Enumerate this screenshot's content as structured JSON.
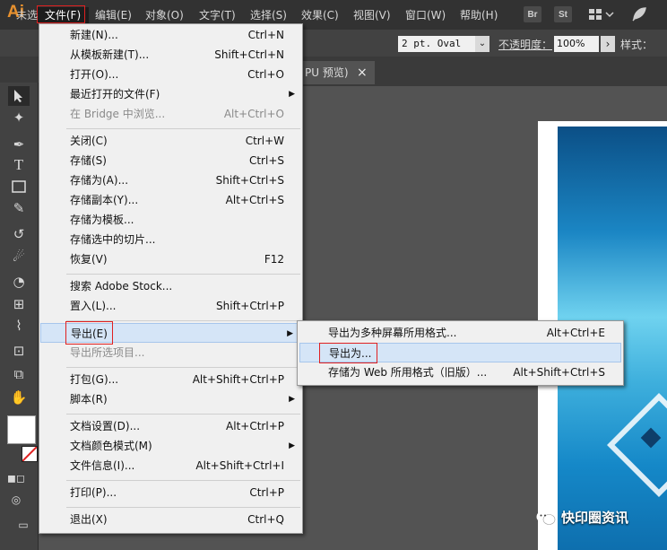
{
  "app": {
    "logo": "Ai"
  },
  "menubar": {
    "items": [
      "文件(F)",
      "编辑(E)",
      "对象(O)",
      "文字(T)",
      "选择(S)",
      "效果(C)",
      "视图(V)",
      "窗口(W)",
      "帮助(H)"
    ],
    "icons": {
      "bridge": "Br",
      "stock": "St",
      "workspace": "workspace-grid-icon",
      "feather": "feather-icon"
    }
  },
  "control_bar": {
    "selection_text": "未选",
    "stroke_profile": "2 pt. Oval",
    "opacity_label": "不透明度：",
    "opacity_value": "100%",
    "style_label": "样式："
  },
  "doc_tab": {
    "title": "PU 预览)",
    "close": "×"
  },
  "file_menu": {
    "items": [
      {
        "label": "新建(N)...",
        "shortcut": "Ctrl+N"
      },
      {
        "label": "从模板新建(T)...",
        "shortcut": "Shift+Ctrl+N"
      },
      {
        "label": "打开(O)...",
        "shortcut": "Ctrl+O"
      },
      {
        "label": "最近打开的文件(F)",
        "shortcut": "▶"
      },
      {
        "label": "在 Bridge 中浏览...",
        "shortcut": "Alt+Ctrl+O"
      },
      {
        "label": "关闭(C)",
        "shortcut": "Ctrl+W"
      },
      {
        "label": "存储(S)",
        "shortcut": "Ctrl+S"
      },
      {
        "label": "存储为(A)...",
        "shortcut": "Shift+Ctrl+S"
      },
      {
        "label": "存储副本(Y)...",
        "shortcut": "Alt+Ctrl+S"
      },
      {
        "label": "存储为模板...",
        "shortcut": ""
      },
      {
        "label": "存储选中的切片...",
        "shortcut": ""
      },
      {
        "label": "恢复(V)",
        "shortcut": "F12"
      },
      {
        "label": "搜索 Adobe Stock...",
        "shortcut": ""
      },
      {
        "label": "置入(L)...",
        "shortcut": "Shift+Ctrl+P"
      },
      {
        "label": "导出(E)",
        "shortcut": "▶"
      },
      {
        "label": "导出所选项目...",
        "shortcut": ""
      },
      {
        "label": "打包(G)...",
        "shortcut": "Alt+Shift+Ctrl+P"
      },
      {
        "label": "脚本(R)",
        "shortcut": "▶"
      },
      {
        "label": "文档设置(D)...",
        "shortcut": "Alt+Ctrl+P"
      },
      {
        "label": "文档颜色模式(M)",
        "shortcut": "▶"
      },
      {
        "label": "文件信息(I)...",
        "shortcut": "Alt+Shift+Ctrl+I"
      },
      {
        "label": "打印(P)...",
        "shortcut": "Ctrl+P"
      },
      {
        "label": "退出(X)",
        "shortcut": "Ctrl+Q"
      }
    ]
  },
  "export_submenu": {
    "items": [
      {
        "label": "导出为多种屏幕所用格式...",
        "shortcut": "Alt+Ctrl+E"
      },
      {
        "label": "导出为...",
        "shortcut": ""
      },
      {
        "label": "存储为 Web 所用格式（旧版）...",
        "shortcut": "Alt+Shift+Ctrl+S"
      }
    ]
  },
  "watermark": {
    "text": "快印圈资讯"
  },
  "colors": {
    "accent_red": "#e02020",
    "highlight": "#d5e5f7",
    "logo_orange": "#e8912e"
  }
}
